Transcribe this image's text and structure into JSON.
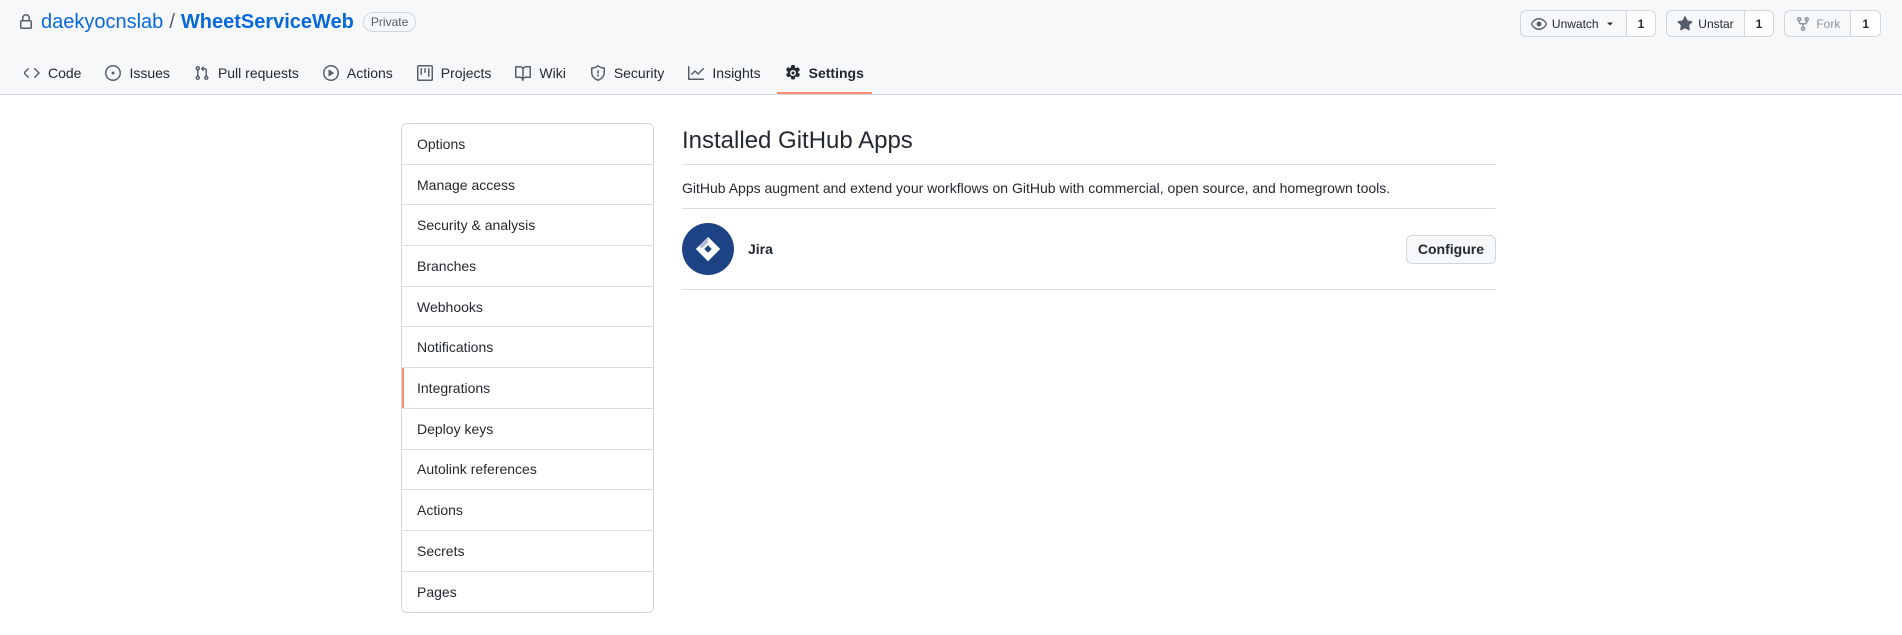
{
  "repo": {
    "owner": "daekyocnslab",
    "separator": "/",
    "name": "WheetServiceWeb",
    "visibility": "Private"
  },
  "header_actions": {
    "watch": {
      "label": "Unwatch",
      "count": "1"
    },
    "star": {
      "label": "Unstar",
      "count": "1"
    },
    "fork": {
      "label": "Fork",
      "count": "1"
    }
  },
  "tabs": [
    {
      "label": "Code",
      "icon": "code-icon"
    },
    {
      "label": "Issues",
      "icon": "issue-icon"
    },
    {
      "label": "Pull requests",
      "icon": "pull-request-icon"
    },
    {
      "label": "Actions",
      "icon": "play-icon"
    },
    {
      "label": "Projects",
      "icon": "project-icon"
    },
    {
      "label": "Wiki",
      "icon": "book-icon"
    },
    {
      "label": "Security",
      "icon": "shield-icon"
    },
    {
      "label": "Insights",
      "icon": "graph-icon"
    },
    {
      "label": "Settings",
      "icon": "gear-icon",
      "selected": true
    }
  ],
  "sidebar": {
    "items": [
      {
        "label": "Options"
      },
      {
        "label": "Manage access"
      },
      {
        "label": "Security & analysis"
      },
      {
        "label": "Branches"
      },
      {
        "label": "Webhooks"
      },
      {
        "label": "Notifications"
      },
      {
        "label": "Integrations",
        "selected": true
      },
      {
        "label": "Deploy keys"
      },
      {
        "label": "Autolink references"
      },
      {
        "label": "Actions"
      },
      {
        "label": "Secrets"
      },
      {
        "label": "Pages"
      }
    ]
  },
  "main": {
    "title": "Installed GitHub Apps",
    "description": "GitHub Apps augment and extend your workflows on GitHub with commercial, open source, and homegrown tools.",
    "apps": [
      {
        "name": "Jira",
        "icon": "jira-logo-icon",
        "action_label": "Configure"
      }
    ]
  },
  "colors": {
    "link": "#0969da",
    "selected_underline": "#fd8c73",
    "jira_blue": "#1d4385"
  }
}
